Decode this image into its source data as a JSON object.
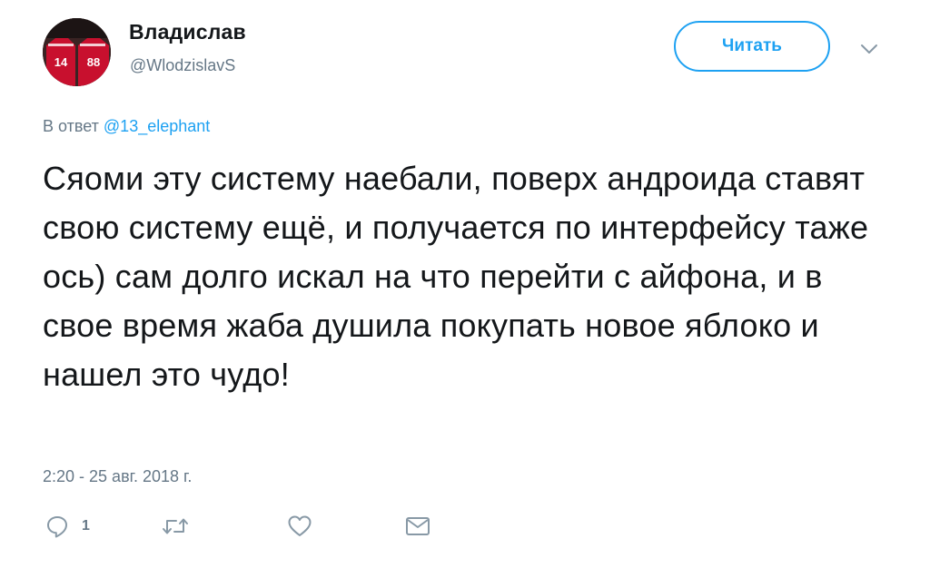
{
  "author": {
    "display_name": "Владислав",
    "handle": "@WlodzislavS",
    "avatar_numbers": [
      "14",
      "88"
    ]
  },
  "follow_button": {
    "label": "Читать"
  },
  "reply_to": {
    "prefix": "В ответ",
    "mention": "@13_elephant"
  },
  "tweet": {
    "text": "Сяоми эту систему наебали, поверх андроида ставят свою систему ещё, и получается по интерфейсу таже ось) сам долго искал на что перейти с айфона, и в свое время жаба душила покупать новое яблоко и нашел это чудо!",
    "timestamp": "2:20 - 25 авг. 2018 г."
  },
  "actions": {
    "reply_count": "1",
    "icons": [
      "reply-icon",
      "retweet-icon",
      "like-icon",
      "direct-message-icon"
    ]
  },
  "colors": {
    "accent": "#1da1f2",
    "secondary_text": "#657786",
    "primary_text": "#14171a"
  }
}
